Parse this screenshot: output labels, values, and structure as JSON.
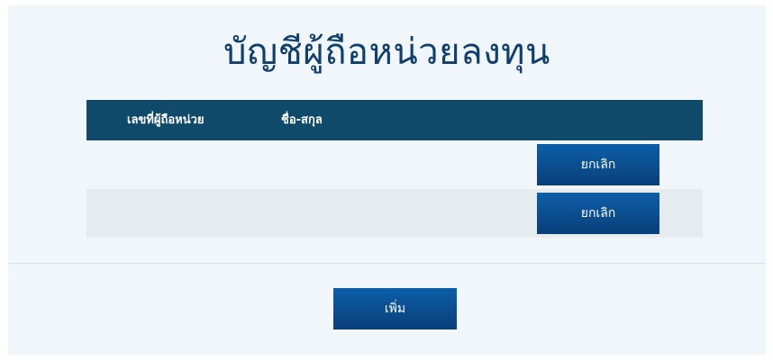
{
  "page": {
    "title": "บัญชีผู้ถือหน่วยลงทุน"
  },
  "table": {
    "headers": {
      "holder_no": "เลขที่ผู้ถือหน่วย",
      "full_name": "ชื่อ-สกุล"
    },
    "rows": [
      {
        "holder_no": "",
        "full_name": "",
        "action_label": "ยกเลิก"
      },
      {
        "holder_no": "",
        "full_name": "",
        "action_label": "ยกเลิก"
      }
    ]
  },
  "footer": {
    "add_label": "เพิ่ม"
  }
}
